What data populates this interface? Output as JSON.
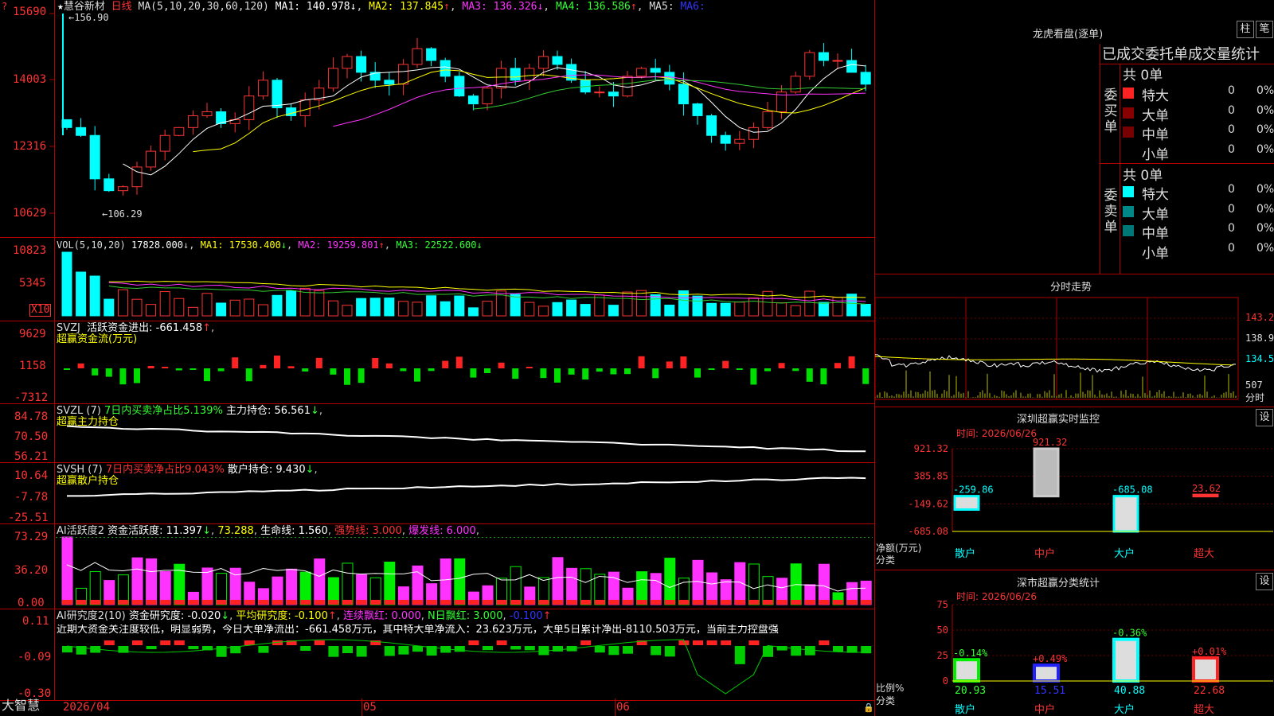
{
  "stock": {
    "star": "★",
    "name": "慧谷新材",
    "period": "日线",
    "ma_params": "MA(5,10,20,30,60,120)",
    "ma1": "MA1: 140.978",
    "ma2": "MA2: 137.845",
    "ma3": "MA3: 136.326",
    "ma4": "MA4: 136.586",
    "ma5": "MA5:",
    "ma6": "MA6:",
    "high_label": "156.90",
    "low_label": "←106.29"
  },
  "axes": {
    "price": [
      "15690",
      "14003",
      "12316",
      "10629"
    ],
    "vol": [
      "10823",
      "5345"
    ],
    "vol_unit": "X10",
    "svzj": [
      "9629",
      "1158",
      "-7312"
    ],
    "svzl": [
      "84.78",
      "70.50",
      "56.21"
    ],
    "svsh": [
      "10.64",
      "-7.78",
      "-25.51"
    ],
    "ai": [
      "73.29",
      "36.20",
      "0.00"
    ],
    "research": [
      "0.11",
      "-0.09",
      "-0.30"
    ]
  },
  "vol": {
    "title": "VOL(5,10,20)",
    "value": "17828.000",
    "ma1": "MA1: 17530.400",
    "ma2": "MA2: 19259.801",
    "ma3": "MA3: 22522.600"
  },
  "svzj": {
    "title": "SVZJ",
    "t1": "活跃资金进出: -661.458",
    "t2": "超赢资金流(万元)"
  },
  "svzl": {
    "title": "SVZL (7)",
    "t1": "7日内买卖净占比5.139%",
    "t2": "主力持仓: 56.561",
    "t3": "超赢主力持仓"
  },
  "svsh": {
    "title": "SVSH (7)",
    "t1": "7日内买卖净占比9.043%",
    "t2": "散户持仓: 9.430",
    "t3": "超赢散户持仓"
  },
  "ai": {
    "t1": "AI活跃度2",
    "t2": "资金活跃度: 11.397",
    "t3": "73.288",
    "t4": "生命线: 1.560",
    "t5": "强势线: 3.000",
    "t6": "爆发线: 6.000"
  },
  "research": {
    "t1": "AI研究度2(10)",
    "t2": "资金研究度: -0.020",
    "t3": "平均研究度: -0.100",
    "t4": "连续飘红: 0.000",
    "t5": "N日飘红: 3.000",
    "t6": "-0.100",
    "note": "近期大资金关注度较低，明显弱势，今日大单净流出：-661.458万元，其中特大单净流入：23.623万元，大单5日累计净出-8110.503万元，当前主力控盘强"
  },
  "xaxis": {
    "d1": "2026/04",
    "d2": "05",
    "d3": "06"
  },
  "brand": "大智慧",
  "right": {
    "title": "龙虎看盘(逐单)",
    "btn1": "柱",
    "btn2": "笔",
    "header": "已成交委托单成交量统计",
    "buy_label": "委买单",
    "sell_label": "委卖单",
    "buy_total": "共 0单",
    "sell_total": "共 0单",
    "buy_rows": [
      {
        "name": "特大",
        "n": "0",
        "p": "0%"
      },
      {
        "name": "大单",
        "n": "0",
        "p": "0%"
      },
      {
        "name": "中单",
        "n": "0",
        "p": "0%"
      },
      {
        "name": "小单",
        "n": "0",
        "p": "0%"
      }
    ],
    "sell_rows": [
      {
        "name": "特大",
        "n": "0",
        "p": "0%"
      },
      {
        "name": "大单",
        "n": "0",
        "p": "0%"
      },
      {
        "name": "中单",
        "n": "0",
        "p": "0%"
      },
      {
        "name": "小单",
        "n": "0",
        "p": "0%"
      }
    ],
    "intraday_title": "分时走势",
    "intraday_y": [
      "143.2",
      "138.9",
      "134.5",
      "507"
    ],
    "intraday_unit": "分时",
    "monitor_title": "深圳超赢实时监控",
    "monitor_btn": "设",
    "monitor_time": "时间: 2026/06/26",
    "monitor_y": [
      "921.32",
      "385.85",
      "-149.62",
      "-685.08"
    ],
    "monitor_vals": [
      "-259.86",
      "921.32",
      "-685.08",
      "23.62"
    ],
    "monitor_ylabel": "净额(万元)",
    "cat_label": "分类",
    "cats": [
      "散户",
      "中户",
      "大户",
      "超大"
    ],
    "class_title": "深市超赢分类统计",
    "class_btn": "设",
    "class_time": "时间: 2026/06/26",
    "class_y": [
      "75",
      "50",
      "25",
      "0"
    ],
    "class_ylabel": "比例%",
    "class_vals": [
      "20.93",
      "15.51",
      "40.88",
      "22.68"
    ],
    "class_chg": [
      "-0.14%",
      "+0.49%",
      "-0.36%",
      "+0.01%"
    ]
  },
  "chart_data": [
    {
      "type": "candlestick",
      "title": "慧谷新材 日线",
      "ylim": [
        106.29,
        156.9
      ],
      "x_labels": [
        "2026/04",
        "05",
        "06"
      ],
      "series": [
        {
          "name": "MA1",
          "values": [
            140.978
          ]
        },
        {
          "name": "MA2",
          "values": [
            137.845
          ]
        },
        {
          "name": "MA3",
          "values": [
            136.326
          ]
        },
        {
          "name": "MA4",
          "values": [
            136.586
          ]
        }
      ],
      "annotations": [
        "156.90",
        "106.29"
      ]
    },
    {
      "type": "bar",
      "title": "VOL(5,10,20)",
      "values": [
        17828.0
      ],
      "series": [
        {
          "name": "MA1",
          "values": [
            17530.4
          ]
        },
        {
          "name": "MA2",
          "values": [
            19259.801
          ]
        },
        {
          "name": "MA3",
          "values": [
            22522.6
          ]
        }
      ]
    },
    {
      "type": "bar",
      "title": "深圳超赢实时监控",
      "categories": [
        "散户",
        "中户",
        "大户",
        "超大"
      ],
      "values": [
        -259.86,
        921.32,
        -685.08,
        23.62
      ],
      "ylabel": "净额(万元)"
    },
    {
      "type": "bar",
      "title": "深市超赢分类统计",
      "categories": [
        "散户",
        "中户",
        "大户",
        "超大"
      ],
      "values": [
        20.93,
        15.51,
        40.88,
        22.68
      ],
      "ylabel": "比例%",
      "ylim": [
        0,
        75
      ]
    }
  ]
}
